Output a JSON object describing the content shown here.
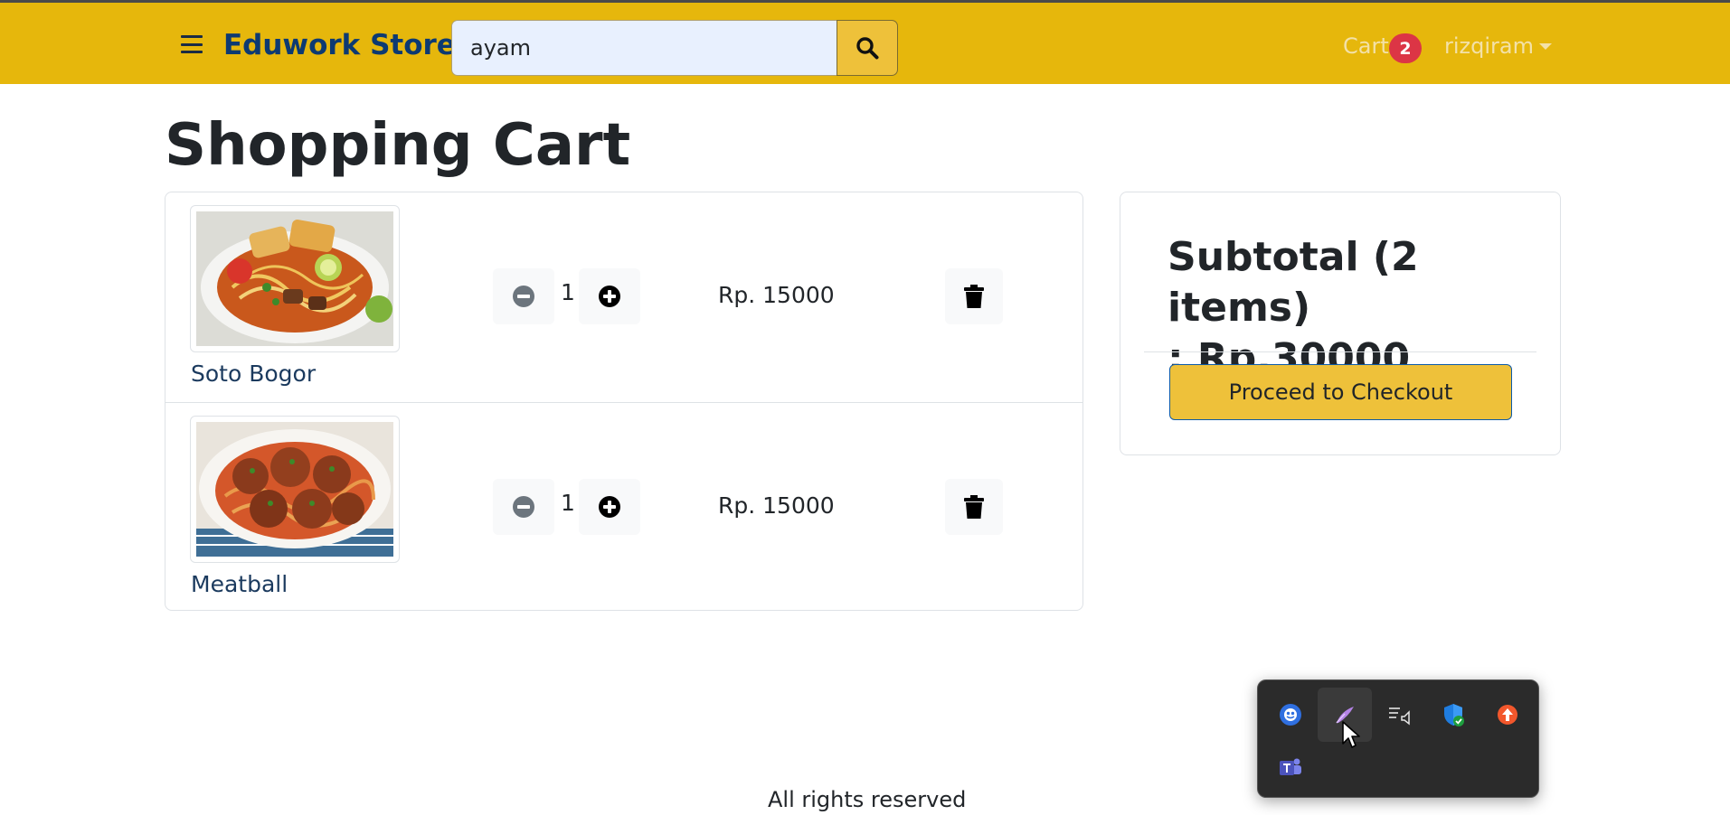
{
  "header": {
    "menu_icon": "hamburger-icon",
    "brand": "Eduwork Store",
    "search": {
      "value": "ayam",
      "placeholder": "",
      "icon": "search-icon"
    },
    "cart_label": "Cart",
    "cart_count": "2",
    "user": "rizqiram",
    "colors": {
      "navbar": "#e6b70c",
      "brand": "#0d3a72",
      "badge": "#dc3545"
    }
  },
  "page": {
    "title": "Shopping Cart"
  },
  "cart": {
    "items": [
      {
        "name": "Soto Bogor",
        "quantity": "1",
        "price": "Rp. 15000",
        "image": "soto-bogor-photo"
      },
      {
        "name": "Meatball",
        "quantity": "1",
        "price": "Rp. 15000",
        "image": "meatball-photo"
      }
    ]
  },
  "summary": {
    "subtotal_line1": "Subtotal (2 items)",
    "subtotal_line2": ": Rp.30000",
    "checkout_label": "Proceed to Checkout",
    "checkout_color": "#eec13a"
  },
  "footer": {
    "text": "All rights reserved"
  },
  "system_tray": {
    "icons": [
      "copilot-icon",
      "pen-icon",
      "narrator-icon",
      "windows-security-icon",
      "update-icon",
      "teams-icon"
    ]
  }
}
